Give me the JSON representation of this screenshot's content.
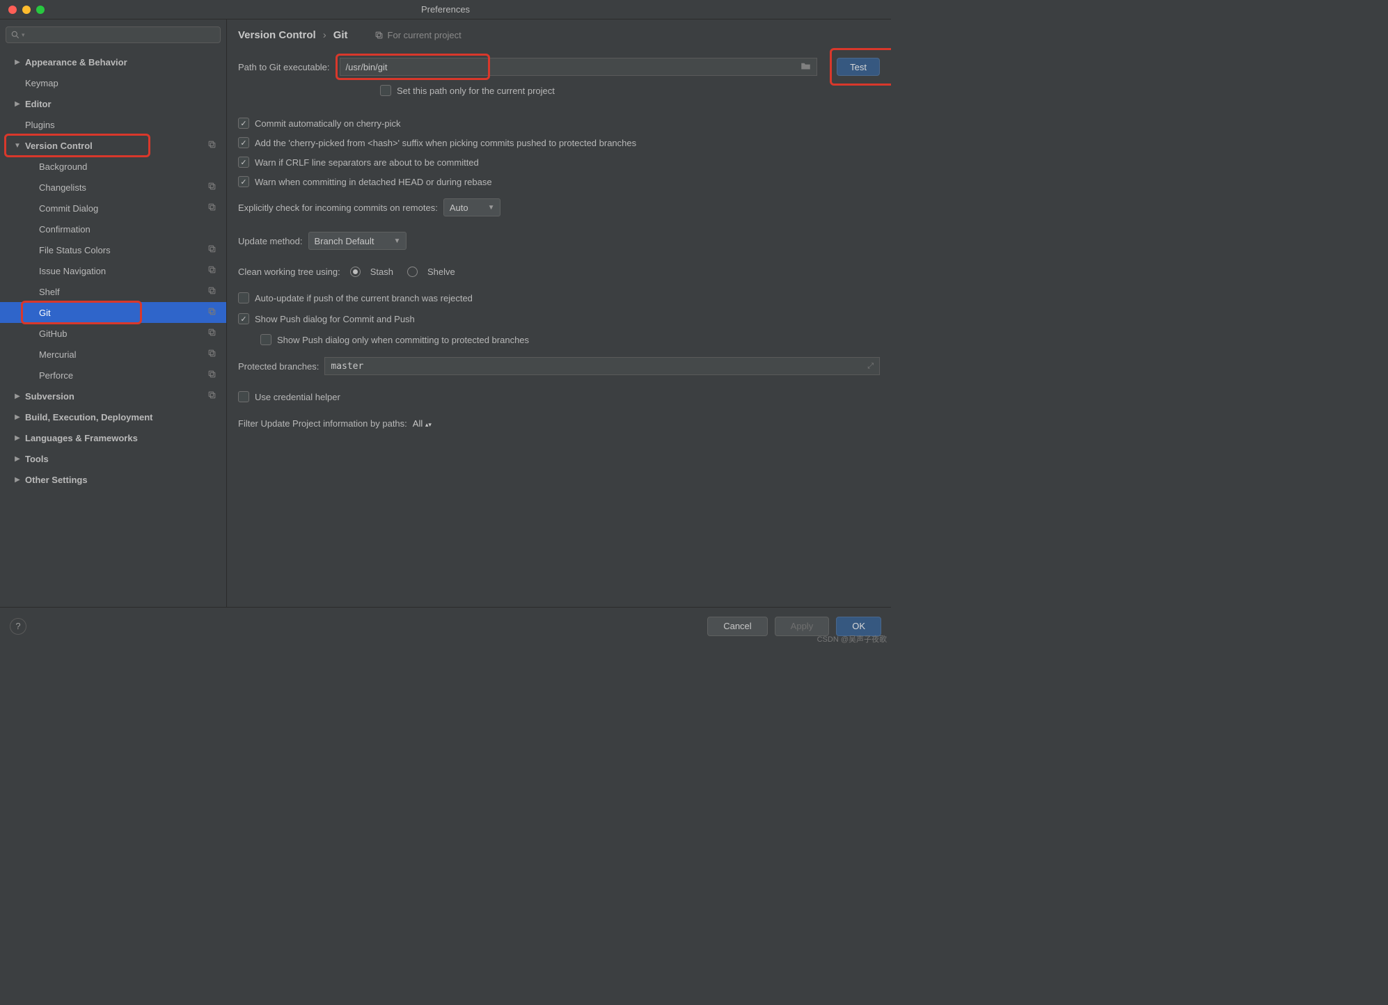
{
  "window": {
    "title": "Preferences"
  },
  "search": {
    "placeholder": ""
  },
  "sidebar": {
    "items": [
      {
        "label": "Appearance & Behavior",
        "expandable": true
      },
      {
        "label": "Keymap"
      },
      {
        "label": "Editor",
        "expandable": true
      },
      {
        "label": "Plugins"
      },
      {
        "label": "Version Control",
        "expandable": true,
        "expanded": true,
        "cp": true
      },
      {
        "label": "Background",
        "child": true
      },
      {
        "label": "Changelists",
        "child": true,
        "cp": true
      },
      {
        "label": "Commit Dialog",
        "child": true,
        "cp": true
      },
      {
        "label": "Confirmation",
        "child": true
      },
      {
        "label": "File Status Colors",
        "child": true,
        "cp": true
      },
      {
        "label": "Issue Navigation",
        "child": true,
        "cp": true
      },
      {
        "label": "Shelf",
        "child": true,
        "cp": true
      },
      {
        "label": "Git",
        "child": true,
        "selected": true,
        "cp": true
      },
      {
        "label": "GitHub",
        "child": true,
        "cp": true
      },
      {
        "label": "Mercurial",
        "child": true,
        "cp": true
      },
      {
        "label": "Perforce",
        "child": true,
        "cp": true
      },
      {
        "label": "Subversion",
        "expandable": true,
        "cp": true
      },
      {
        "label": "Build, Execution, Deployment",
        "expandable": true
      },
      {
        "label": "Languages & Frameworks",
        "expandable": true
      },
      {
        "label": "Tools",
        "expandable": true
      },
      {
        "label": "Other Settings",
        "expandable": true
      }
    ]
  },
  "breadcrumb": {
    "a": "Version Control",
    "b": "Git",
    "scope": "For current project"
  },
  "form": {
    "path_label": "Path to Git executable:",
    "path_value": "/usr/bin/git",
    "test_label": "Test",
    "set_path_project": "Set this path only for the current project",
    "c1": "Commit automatically on cherry-pick",
    "c2": "Add the 'cherry-picked from <hash>' suffix when picking commits pushed to protected branches",
    "c3": "Warn if CRLF line separators are about to be committed",
    "c4": "Warn when committing in detached HEAD or during rebase",
    "explicit_label": "Explicitly check for incoming commits on remotes:",
    "explicit_value": "Auto",
    "update_label": "Update method:",
    "update_value": "Branch Default",
    "clean_label": "Clean working tree using:",
    "clean_stash": "Stash",
    "clean_shelve": "Shelve",
    "auto_update": "Auto-update if push of the current branch was rejected",
    "show_push": "Show Push dialog for Commit and Push",
    "show_push_sub": "Show Push dialog only when committing to protected branches",
    "protected_label": "Protected branches:",
    "protected_value": "master",
    "cred_helper": "Use credential helper",
    "filter_label": "Filter Update Project information by paths:",
    "filter_value": "All"
  },
  "footer": {
    "cancel": "Cancel",
    "apply": "Apply",
    "ok": "OK"
  },
  "watermark": "CSDN @吴声子夜歌"
}
